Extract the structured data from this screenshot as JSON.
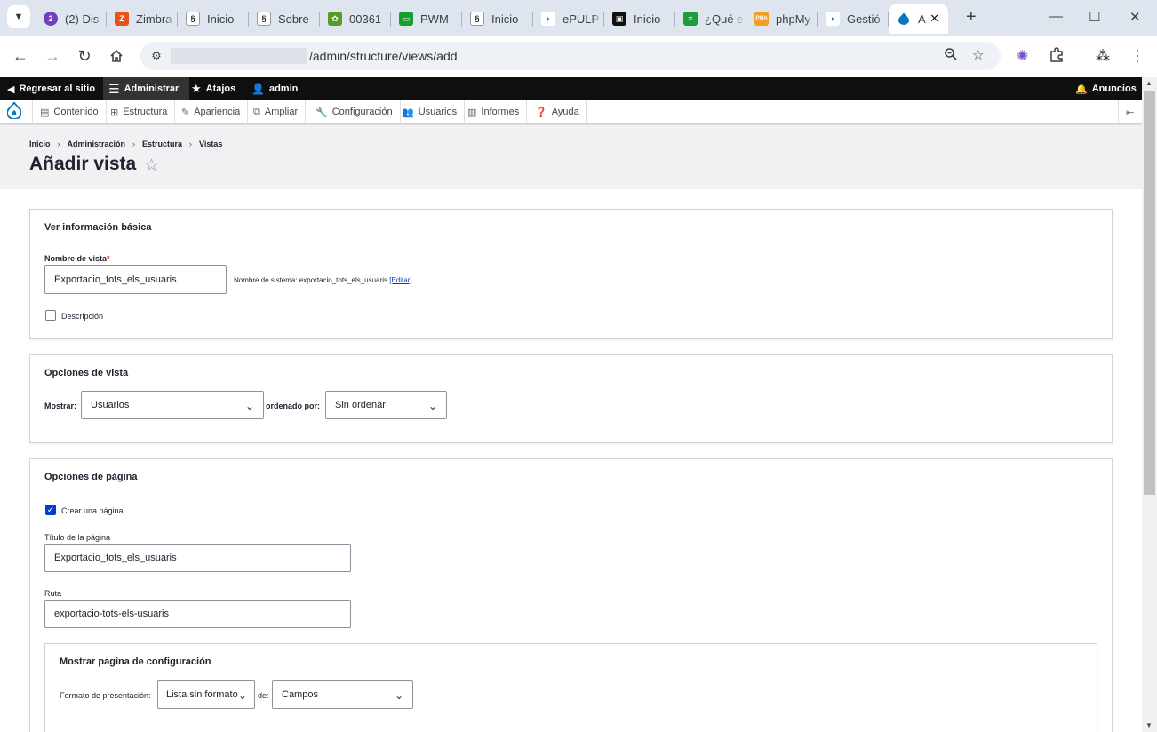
{
  "browser": {
    "tabs": [
      {
        "label": "(2) Dis",
        "fav": "2",
        "fav_color": "#6f42c1"
      },
      {
        "label": "Zimbra",
        "fav": "Z",
        "fav_color": "#e8521b"
      },
      {
        "label": "Inicio",
        "fav": "§",
        "fav_color": "#222222"
      },
      {
        "label": "Sobre",
        "fav": "§",
        "fav_color": "#222222"
      },
      {
        "label": "00361",
        "fav": "✿",
        "fav_color": "#5a9a26"
      },
      {
        "label": "PWM",
        "fav": "▭",
        "fav_color": "#14a02a"
      },
      {
        "label": "Inicio",
        "fav": "§",
        "fav_color": "#222222"
      },
      {
        "label": "ePULP",
        "fav": "◗",
        "fav_color": "#1a6fc4"
      },
      {
        "label": "Inicio",
        "fav": "▣",
        "fav_color": "#111111"
      },
      {
        "label": "¿Qué e",
        "fav": "≡",
        "fav_color": "#1e9c3c"
      },
      {
        "label": "phpMy",
        "fav": "PMA",
        "fav_color": "#f0a01e"
      },
      {
        "label": "Gestió",
        "fav": "◗",
        "fav_color": "#1a6fc4"
      }
    ],
    "active_tab": {
      "label": "Añadir",
      "fav": "💧",
      "fav_color": "#0678be"
    },
    "url_path": "/admin/structure/views/add"
  },
  "admin_bar": {
    "back": "Regresar al sitio",
    "manage": "Administrar",
    "shortcuts": "Atajos",
    "user": "admin",
    "announcements": "Anuncios"
  },
  "tray": {
    "items": [
      "Contenido",
      "Estructura",
      "Apariencia",
      "Ampliar",
      "Configuración",
      "Usuarios",
      "Informes",
      "Ayuda"
    ]
  },
  "breadcrumb": [
    "Inicio",
    "Administración",
    "Estructura",
    "Vistas"
  ],
  "page_title": "Añadir vista",
  "basic": {
    "legend": "Ver información básica",
    "name_label": "Nombre de vista",
    "required_mark": "*",
    "name_value": "Exportacio_tots_els_usuaris",
    "machine_name_prefix": "Nombre de sistema: exportacio_tots_els_usuaris",
    "edit_link": "[Editar]",
    "description_label": "Descripción",
    "description_checked": false
  },
  "view_options": {
    "legend": "Opciones de vista",
    "show_label": "Mostrar:",
    "show_value": "Usuarios",
    "sorted_label": "ordenado por:",
    "sorted_value": "Sin ordenar"
  },
  "page_options": {
    "legend": "Opciones de página",
    "create_page_label": "Crear una página",
    "create_page_checked": true,
    "title_label": "Título de la página",
    "title_value": "Exportacio_tots_els_usuaris",
    "path_label": "Ruta",
    "path_value": "exportacio-tots-els-usuaris",
    "display_legend": "Mostrar pagina de configuración",
    "format_label": "Formato de presentación:",
    "format_value": "Lista sin formato",
    "of_label": "de:",
    "of_value": "Campos"
  }
}
